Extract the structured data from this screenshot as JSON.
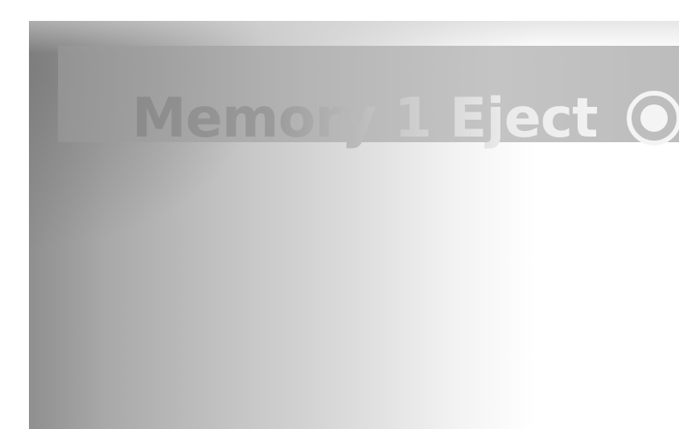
{
  "menu": {
    "item_label": "Memory 1 Eject",
    "icon": "record-icon"
  }
}
